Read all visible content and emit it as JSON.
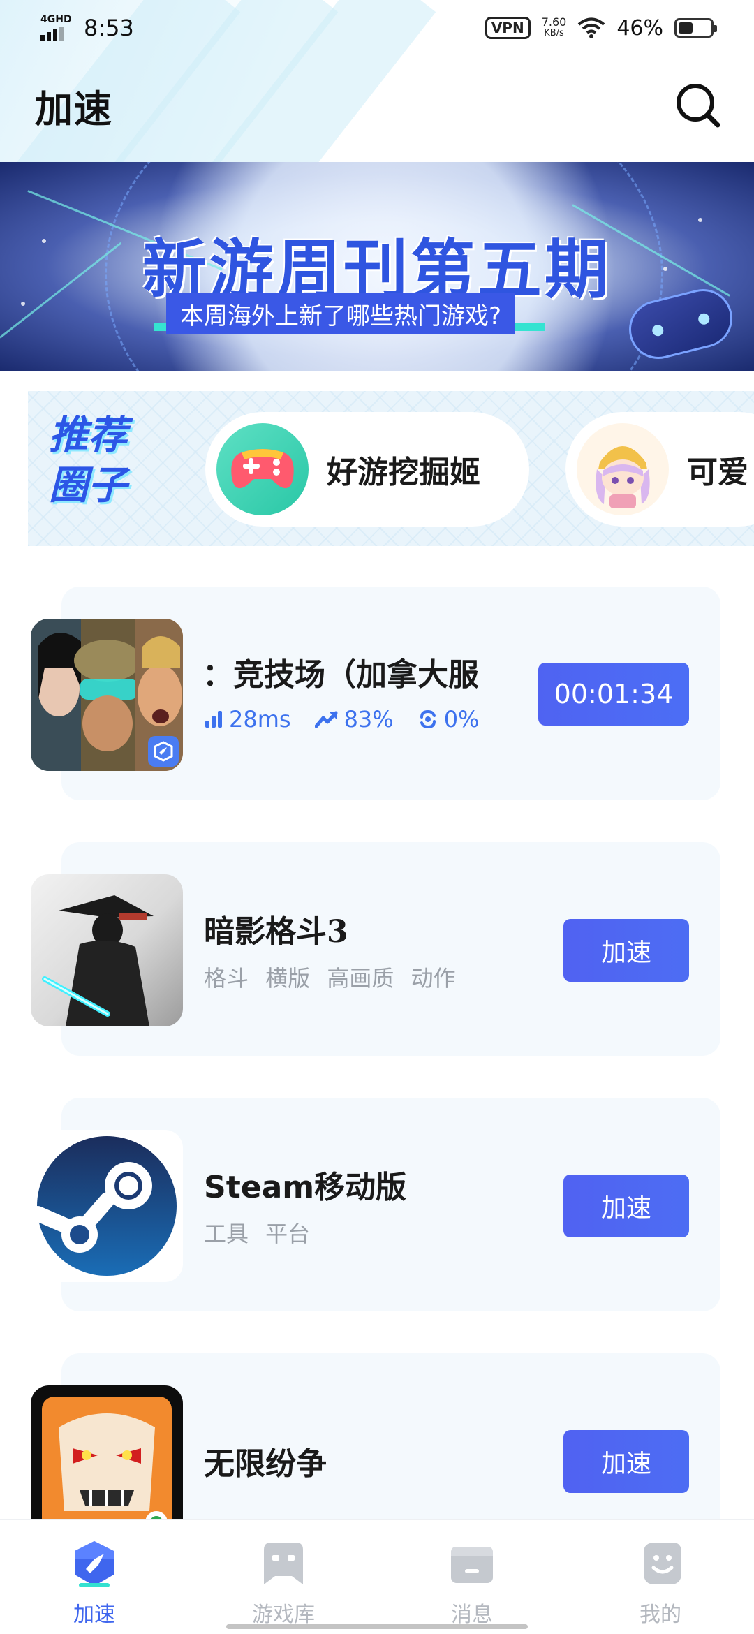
{
  "status_bar": {
    "network": "4G HD",
    "time": "8:53",
    "vpn": "VPN",
    "speed_value": "7.60",
    "speed_unit": "KB/s",
    "battery": "46%"
  },
  "header": {
    "title": "加速"
  },
  "banner": {
    "title": "新游周刊第五期",
    "subtitle": "本周海外上新了哪些热门游戏?"
  },
  "circles": {
    "label": "推荐圈子",
    "items": [
      {
        "name": "好游挖掘姬",
        "icon": "gamepad-icon"
      },
      {
        "name": "可爱",
        "icon": "anime-avatar"
      }
    ]
  },
  "games": [
    {
      "title": "：竞技场（加拿大服",
      "latency": "28ms",
      "improvement": "83%",
      "packet_loss": "0%",
      "timer": "00:01:34",
      "icon": "arena-heroes-icon"
    },
    {
      "title": "暗影格斗3",
      "tags": "格斗  横版  高画质  动作",
      "button": "加速",
      "icon": "shadow-fight-icon"
    },
    {
      "title": "Steam移动版",
      "tags": "工具  平台",
      "button": "加速",
      "icon": "steam-icon"
    },
    {
      "title": "无限纷争",
      "tags": "",
      "button": "加速",
      "icon": "bleach-icon"
    }
  ],
  "tabbar": [
    {
      "label": "加速",
      "icon": "accelerate-icon",
      "active": true
    },
    {
      "label": "游戏库",
      "icon": "game-library-icon",
      "active": false
    },
    {
      "label": "消息",
      "icon": "message-icon",
      "active": false
    },
    {
      "label": "我的",
      "icon": "profile-icon",
      "active": false
    }
  ],
  "colors": {
    "accent": "#3f66ee",
    "button": "#5062f2",
    "card_bg": "#f4f9fd",
    "tab_inactive": "#b4b8bf"
  }
}
